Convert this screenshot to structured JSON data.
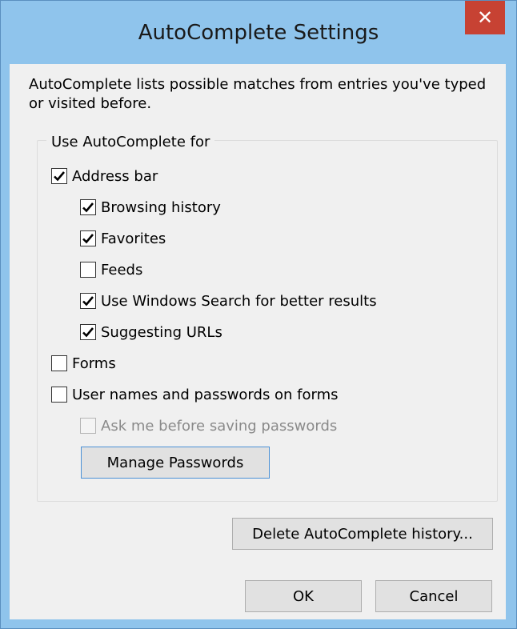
{
  "window": {
    "title": "AutoComplete Settings",
    "close_glyph": "✕"
  },
  "description": "AutoComplete lists possible matches from entries you've typed or visited before.",
  "group": {
    "legend": "Use AutoComplete for",
    "items": [
      {
        "label": "Address bar",
        "checked": true,
        "disabled": false
      },
      {
        "label": "Browsing history",
        "checked": true,
        "disabled": false
      },
      {
        "label": "Favorites",
        "checked": true,
        "disabled": false
      },
      {
        "label": "Feeds",
        "checked": false,
        "disabled": false
      },
      {
        "label": "Use Windows Search for better results",
        "checked": true,
        "disabled": false
      },
      {
        "label": "Suggesting URLs",
        "checked": true,
        "disabled": false
      },
      {
        "label": "Forms",
        "checked": false,
        "disabled": false
      },
      {
        "label": "User names and passwords on forms",
        "checked": false,
        "disabled": false
      },
      {
        "label": "Ask me before saving passwords",
        "checked": false,
        "disabled": true
      }
    ],
    "manage_passwords_label": "Manage Passwords"
  },
  "buttons": {
    "delete_history_label": "Delete AutoComplete history...",
    "ok_label": "OK",
    "cancel_label": "Cancel"
  }
}
